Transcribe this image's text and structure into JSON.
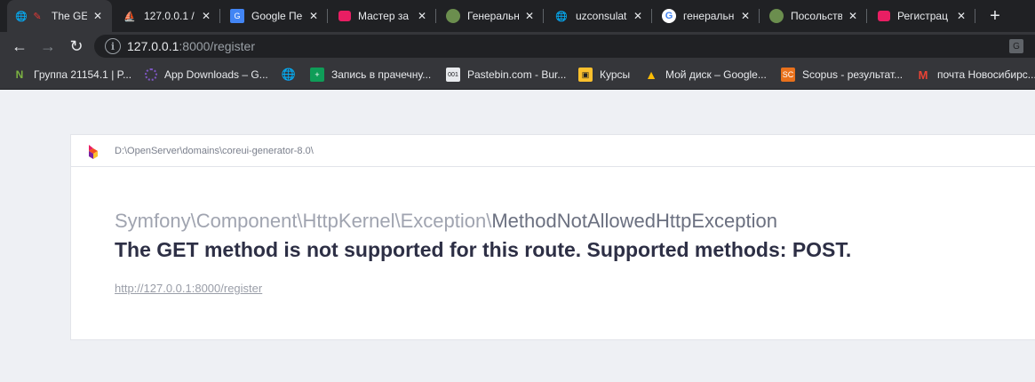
{
  "tabs": [
    {
      "title": "The GET",
      "favicon": "red-laravel-icon",
      "active": true
    },
    {
      "title": "127.0.0.1 /",
      "favicon": "phpmyadmin-icon",
      "active": false
    },
    {
      "title": "Google Пе",
      "favicon": "google-translate-icon",
      "active": false
    },
    {
      "title": "Мастер за",
      "favicon": "pink-app-icon",
      "active": false
    },
    {
      "title": "Генеральн",
      "favicon": "emblem-icon",
      "active": false
    },
    {
      "title": "uzconsulat",
      "favicon": "globe-icon",
      "active": false
    },
    {
      "title": "генеральн",
      "favicon": "google-icon",
      "active": false
    },
    {
      "title": "Посольств",
      "favicon": "emblem-icon",
      "active": false
    },
    {
      "title": "Регистрац",
      "favicon": "pink-app-icon",
      "active": false
    }
  ],
  "toolbar": {
    "url_host": "127.0.0.1",
    "url_rest": ":8000/register"
  },
  "bookmarks": [
    {
      "label": "Группа 21154.1 | P...",
      "icon": "n-icon"
    },
    {
      "label": "App Downloads – G...",
      "icon": "loading-circle-icon"
    },
    {
      "label": "",
      "icon": "globe-icon"
    },
    {
      "label": "Запись в прачечну...",
      "icon": "green-sheet-icon"
    },
    {
      "label": "Pastebin.com - Bur...",
      "icon": "pastebin-icon"
    },
    {
      "label": "Курсы",
      "icon": "course-icon"
    },
    {
      "label": "Мой диск – Google...",
      "icon": "google-drive-icon"
    },
    {
      "label": "Scopus - результат...",
      "icon": "scopus-icon"
    },
    {
      "label": "почта Новосибирс...",
      "icon": "gmail-icon"
    }
  ],
  "error": {
    "path": "D:\\OpenServer\\domains\\coreui-generator-8.0\\",
    "class_namespace": "Symfony\\Component\\HttpKernel\\Exception\\",
    "class_short": "MethodNotAllowedHttpException",
    "message": "The GET method is not supported for this route. Supported methods: POST.",
    "url": "http://127.0.0.1:8000/register"
  },
  "colors": {
    "chrome_dark": "#202124",
    "chrome_toolbar": "#35363a",
    "page_bg": "#eef0f4",
    "message": "#2d2f45"
  }
}
